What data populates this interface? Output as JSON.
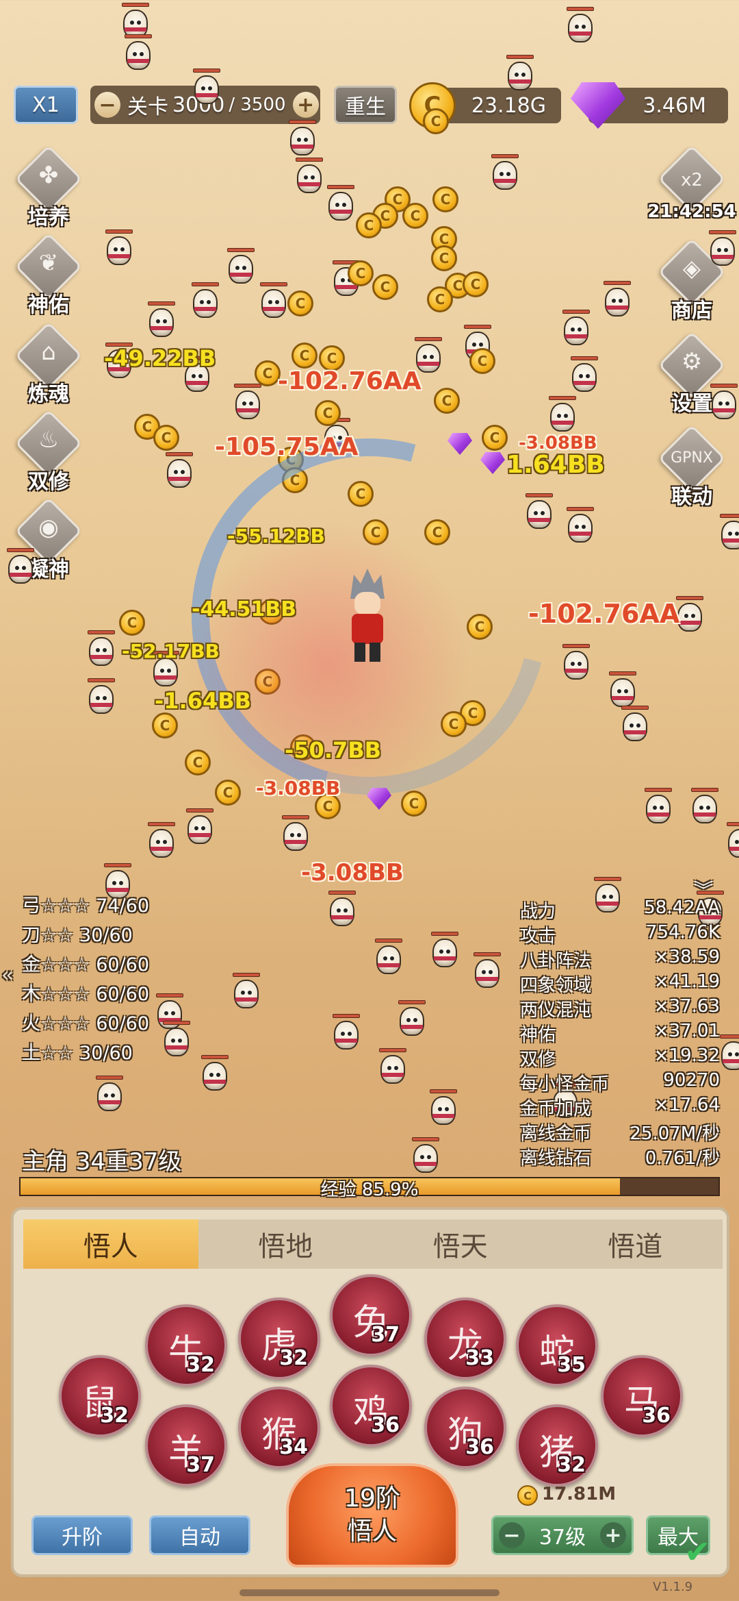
{
  "top_bar": {
    "speed_label": "X1",
    "stage_label": "关卡",
    "stage_current": "3000",
    "stage_total": "/ 3500",
    "rebirth_label": "重生",
    "gold_amount": "23.18G",
    "gem_amount": "3.46M"
  },
  "side_left": [
    {
      "label": "培养",
      "icon": "clover-icon"
    },
    {
      "label": "神佑",
      "icon": "wings-icon"
    },
    {
      "label": "炼魂",
      "icon": "house-icon"
    },
    {
      "label": "双修",
      "icon": "fire-icon"
    },
    {
      "label": "凝神",
      "icon": "target-icon"
    }
  ],
  "side_right": {
    "boost_label": "x2",
    "boost_timer": "21:42:54",
    "shop_label": "商店",
    "settings_label": "设置",
    "link_label": "联动"
  },
  "damage_numbers": [
    {
      "text": "-49.22BB",
      "color": "yellow"
    },
    {
      "text": "-102.76AA",
      "color": "red"
    },
    {
      "text": "-105.75AA",
      "color": "red"
    },
    {
      "text": "-3.08BB",
      "color": "red"
    },
    {
      "text": "1.64BB",
      "color": "yellow"
    },
    {
      "text": "-55.12BB",
      "color": "yellow"
    },
    {
      "text": "-44.51BB",
      "color": "yellow"
    },
    {
      "text": "-102.76AA",
      "color": "red"
    },
    {
      "text": "-52.17BB",
      "color": "yellow"
    },
    {
      "text": "-1.64BB",
      "color": "yellow"
    },
    {
      "text": "-50.7BB",
      "color": "yellow"
    },
    {
      "text": "-3.08BB",
      "color": "red"
    },
    {
      "text": "-3.08BB",
      "color": "red"
    }
  ],
  "stats_left": [
    {
      "name": "弓",
      "stars": "☆☆☆",
      "value": "74/60"
    },
    {
      "name": "刀",
      "stars": "☆☆",
      "value": "30/60"
    },
    {
      "name": "金",
      "stars": "☆☆☆",
      "value": "60/60"
    },
    {
      "name": "木",
      "stars": "☆☆☆",
      "value": "60/60"
    },
    {
      "name": "火",
      "stars": "☆☆☆",
      "value": "60/60"
    },
    {
      "name": "土",
      "stars": "☆☆",
      "value": "30/60"
    }
  ],
  "stats_right": [
    {
      "label": "战力",
      "value": "58.42AA"
    },
    {
      "label": "攻击",
      "value": "754.76K"
    },
    {
      "label": "八卦阵法",
      "value": "×38.59"
    },
    {
      "label": "四象领域",
      "value": "×41.19"
    },
    {
      "label": "两仪混沌",
      "value": "×37.63"
    },
    {
      "label": "神佑",
      "value": "×37.01"
    },
    {
      "label": "双修",
      "value": "×19.32"
    },
    {
      "label": "每小怪金币",
      "value": "90270"
    },
    {
      "label": "金币加成",
      "value": "×17.64"
    },
    {
      "label": "离线金币",
      "value": "25.07M/秒"
    },
    {
      "label": "离线钻石",
      "value": "0.761/秒"
    }
  ],
  "hero": {
    "level_text": "主角 34重37级",
    "exp_text": "经验 85.9%",
    "exp_fraction": 0.859
  },
  "panel": {
    "tabs": [
      "悟人",
      "悟地",
      "悟天",
      "悟道"
    ],
    "active_tab": 0,
    "zodiac": [
      {
        "name": "rat-icon",
        "symbol": "鼠",
        "level": "32"
      },
      {
        "name": "ox-icon",
        "symbol": "牛",
        "level": "32"
      },
      {
        "name": "tiger-icon",
        "symbol": "虎",
        "level": "32"
      },
      {
        "name": "rabbit-icon",
        "symbol": "兔",
        "level": "37"
      },
      {
        "name": "dragon-icon",
        "symbol": "龙",
        "level": "33"
      },
      {
        "name": "snake-icon",
        "symbol": "蛇",
        "level": "35"
      },
      {
        "name": "horse-icon",
        "symbol": "马",
        "level": "36"
      },
      {
        "name": "goat-icon",
        "symbol": "羊",
        "level": "37"
      },
      {
        "name": "monkey-icon",
        "symbol": "猴",
        "level": "34"
      },
      {
        "name": "rooster-icon",
        "symbol": "鸡",
        "level": "36"
      },
      {
        "name": "dog-icon",
        "symbol": "狗",
        "level": "36"
      },
      {
        "name": "pig-icon",
        "symbol": "猪",
        "level": "32"
      }
    ],
    "upgrade_label": "升阶",
    "auto_label": "自动",
    "tier_line1": "19阶",
    "tier_line2": "悟人",
    "cost_amount": "17.81M",
    "level_stepper": "37级",
    "max_label": "最大"
  },
  "version": "V1.1.9"
}
